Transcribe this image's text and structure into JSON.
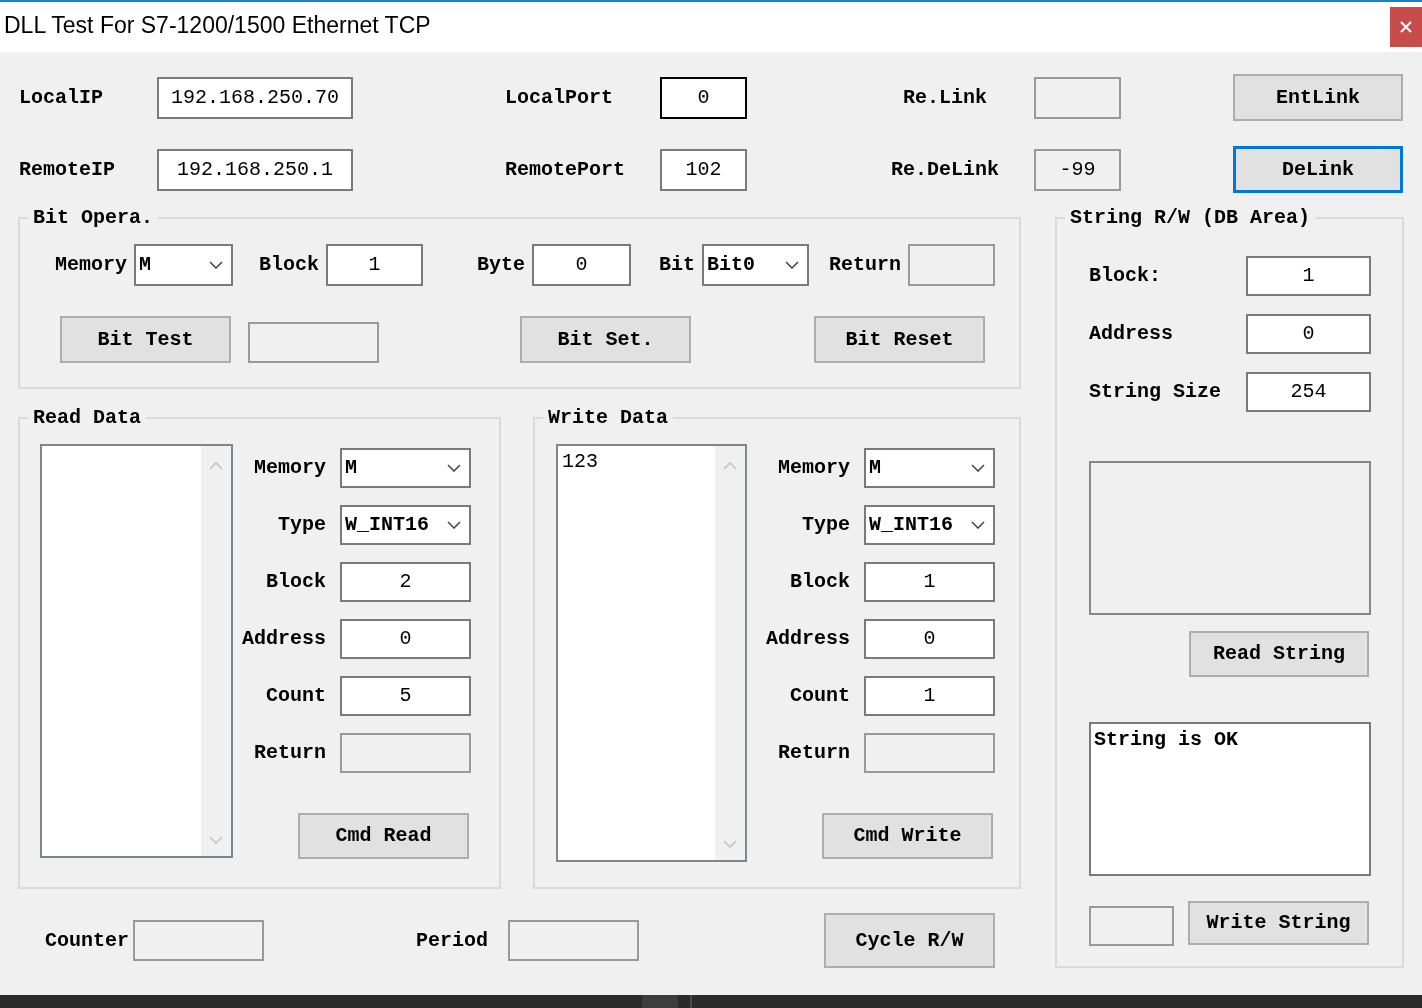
{
  "window": {
    "title": "DLL Test For S7-1200/1500 Ethernet TCP"
  },
  "connection": {
    "rows": [
      [
        {
          "kind": "field",
          "label": "LocalIP",
          "value": "192.168.250.70",
          "readonly": false,
          "focused": false
        },
        {
          "kind": "field",
          "label": "LocalPort",
          "value": "0",
          "readonly": false,
          "focused": true
        },
        {
          "kind": "field",
          "label": "Re.Link",
          "readonly": true,
          "focused": false
        },
        {
          "kind": "button",
          "label": "EntLink",
          "focused": false
        }
      ],
      [
        {
          "kind": "field",
          "label": "RemoteIP",
          "value": "192.168.250.1",
          "readonly": false,
          "focused": false
        },
        {
          "kind": "field",
          "label": "RemotePort",
          "value": "102",
          "readonly": false,
          "focused": false
        },
        {
          "kind": "field",
          "label": "Re.DeLink",
          "value": "-99",
          "readonly": true,
          "focused": false
        },
        {
          "kind": "button",
          "label": "DeLink",
          "focused": true
        }
      ]
    ]
  },
  "bit_opera": {
    "title": "Bit Opera.",
    "fields": [
      {
        "kind": "combo",
        "label": "Memory",
        "value": "M"
      },
      {
        "kind": "field",
        "label": "Block",
        "value": "1",
        "readonly": false
      },
      {
        "kind": "field",
        "label": "Byte",
        "value": "0",
        "readonly": false
      },
      {
        "kind": "combo",
        "label": "Bit",
        "value": "Bit0"
      },
      {
        "kind": "field",
        "label": "Return",
        "readonly": true
      }
    ],
    "actions": [
      {
        "kind": "button",
        "label": "Bit Test",
        "focused": false
      },
      {
        "kind": "field",
        "readonly": true
      },
      {
        "kind": "button",
        "label": "Bit Set.",
        "focused": false
      },
      {
        "kind": "button",
        "label": "Bit Reset",
        "focused": false
      }
    ]
  },
  "read_data": {
    "title": "Read Data",
    "fields": [
      {
        "kind": "combo",
        "label": "Memory",
        "value": "M"
      },
      {
        "kind": "combo",
        "label": "Type",
        "value": "W_INT16"
      },
      {
        "kind": "field",
        "label": "Block",
        "value": "2",
        "readonly": false
      },
      {
        "kind": "field",
        "label": "Address",
        "value": "0",
        "readonly": false
      },
      {
        "kind": "field",
        "label": "Count",
        "value": "5",
        "readonly": false
      },
      {
        "kind": "field",
        "label": "Return",
        "readonly": true
      }
    ],
    "button": {
      "label": "Cmd Read",
      "focused": false
    }
  },
  "write_data": {
    "title": "Write Data",
    "list_items": [
      "123"
    ],
    "fields": [
      {
        "kind": "combo",
        "label": "Memory",
        "value": "M"
      },
      {
        "kind": "combo",
        "label": "Type",
        "value": "W_INT16"
      },
      {
        "kind": "field",
        "label": "Block",
        "value": "1",
        "readonly": false
      },
      {
        "kind": "field",
        "label": "Address",
        "value": "0",
        "readonly": false
      },
      {
        "kind": "field",
        "label": "Count",
        "value": "1",
        "readonly": false
      },
      {
        "kind": "field",
        "label": "Return",
        "readonly": true
      }
    ],
    "button": {
      "label": "Cmd Write",
      "focused": false
    }
  },
  "string_rw": {
    "title": "String R/W (DB Area)",
    "fields": [
      {
        "label": "Block:",
        "value": "1",
        "readonly": false
      },
      {
        "label": "Address",
        "value": "0",
        "readonly": false
      },
      {
        "label": "String Size",
        "value": "254",
        "readonly": false
      }
    ],
    "read_box": {
      "readonly": true
    },
    "read_button": {
      "label": "Read String",
      "focused": false
    },
    "write_box": {
      "value": "String is OK",
      "readonly": false
    },
    "write_status": {
      "readonly": true
    },
    "write_button": {
      "label": "Write String",
      "focused": false
    }
  },
  "footer": {
    "fields": [
      {
        "label": "Counter",
        "readonly": true
      },
      {
        "label": "Period",
        "readonly": true
      }
    ],
    "button": {
      "label": "Cycle R/W",
      "focused": false
    }
  }
}
